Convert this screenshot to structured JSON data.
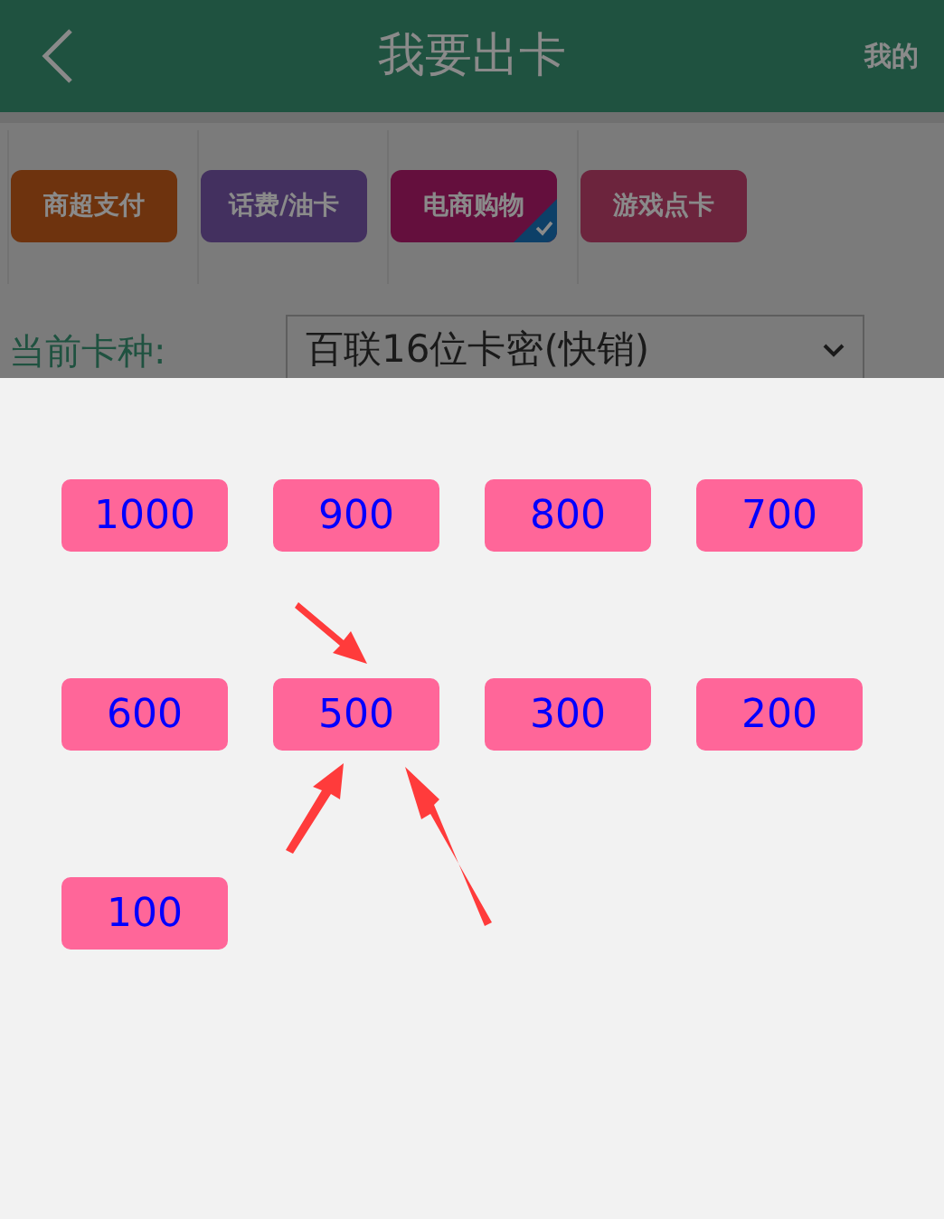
{
  "header": {
    "title": "我要出卡",
    "right_link": "我的"
  },
  "categories": [
    {
      "label": "商超支付",
      "color": "#6e330e",
      "selected": false
    },
    {
      "label": "话费/油卡",
      "color": "#43305f",
      "selected": false
    },
    {
      "label": "电商购物",
      "color": "#640f3d",
      "selected": true
    },
    {
      "label": "游戏点卡",
      "color": "#6c243d",
      "selected": false
    }
  ],
  "card_type": {
    "label": "当前卡种:",
    "value": "百联16位卡密(快销)"
  },
  "amounts": [
    {
      "label": "1000"
    },
    {
      "label": "900"
    },
    {
      "label": "800"
    },
    {
      "label": "700"
    },
    {
      "label": "600"
    },
    {
      "label": "500"
    },
    {
      "label": "300"
    },
    {
      "label": "200"
    },
    {
      "label": "100"
    }
  ]
}
